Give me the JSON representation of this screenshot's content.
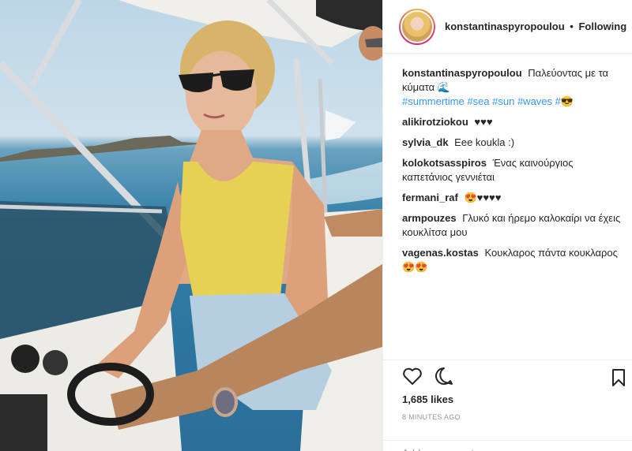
{
  "post": {
    "username": "konstantinaspyropoulou",
    "follow_status": "Following",
    "separator": "•"
  },
  "caption": {
    "username": "konstantinaspyropoulou",
    "text": "Παλεύοντας με τα κύματα 🌊",
    "hashtags": "#summertime #sea #sun #waves #😎"
  },
  "comments": [
    {
      "username": "alikirotziokou",
      "text": "♥♥♥"
    },
    {
      "username": "sylvia_dk",
      "text": "Eee koukla :)"
    },
    {
      "username": "kolokotsasspiros",
      "text": "Ένας καινούργιος καπετάνιος γεννιέται"
    },
    {
      "username": "fermani_raf",
      "text": "😍♥♥♥♥"
    },
    {
      "username": "armpouzes",
      "text": "Γλυκό και ήρεμο καλοκαίρι να έχεις κουκλίτσα μου"
    },
    {
      "username": "vagenas.kostas",
      "text": "Κουκλαρος πάντα κουκλαρος 😍😍"
    }
  ],
  "stats": {
    "likes": "1,685 likes",
    "time_ago": "8 MINUTES AGO"
  },
  "add_comment": {
    "placeholder": "Add a comment..."
  },
  "icons": {
    "like": "heart-icon",
    "comment": "comment-bubble-icon",
    "save": "bookmark-icon"
  }
}
